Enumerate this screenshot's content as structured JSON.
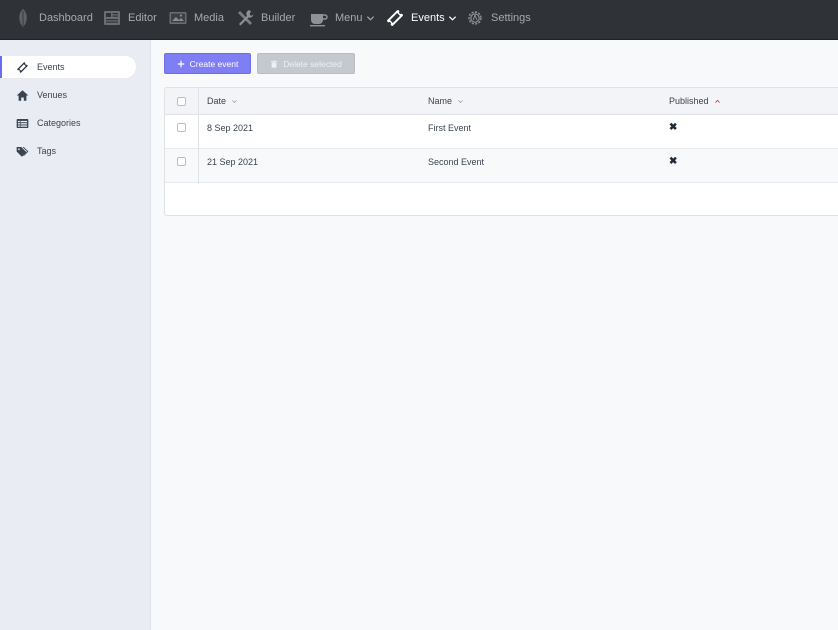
{
  "nav": {
    "items": [
      {
        "id": "dashboard",
        "label": "Dashboard",
        "icon": "leaf-icon"
      },
      {
        "id": "editor",
        "label": "Editor",
        "icon": "newspaper-icon"
      },
      {
        "id": "media",
        "label": "Media",
        "icon": "image-icon"
      },
      {
        "id": "builder",
        "label": "Builder",
        "icon": "tools-icon"
      },
      {
        "id": "menu",
        "label": "Menu",
        "icon": "coffee-icon",
        "dropdown": true
      },
      {
        "id": "events",
        "label": "Events",
        "icon": "ticket-icon",
        "dropdown": true,
        "active": true
      },
      {
        "id": "settings",
        "label": "Settings",
        "icon": "gear-icon"
      }
    ]
  },
  "sidebar": {
    "items": [
      {
        "label": "Events",
        "icon": "ticket-icon",
        "active": true
      },
      {
        "label": "Venues",
        "icon": "home-icon"
      },
      {
        "label": "Categories",
        "icon": "list-icon"
      },
      {
        "label": "Tags",
        "icon": "tags-icon"
      }
    ]
  },
  "toolbar": {
    "create_label": "Create event",
    "delete_label": "Delete selected"
  },
  "table": {
    "columns": [
      {
        "label": "Date",
        "sort": "none"
      },
      {
        "label": "Name",
        "sort": "none"
      },
      {
        "label": "Published",
        "sort": "asc"
      }
    ],
    "rows": [
      {
        "date": "8 Sep 2021",
        "name": "First Event",
        "published": "✖"
      },
      {
        "date": "21 Sep 2021",
        "name": "Second Event",
        "published": "✖"
      }
    ]
  },
  "colors": {
    "topbar": "#2f3236",
    "accent": "#7f7ef5",
    "sort_active": "#e53e3e"
  }
}
